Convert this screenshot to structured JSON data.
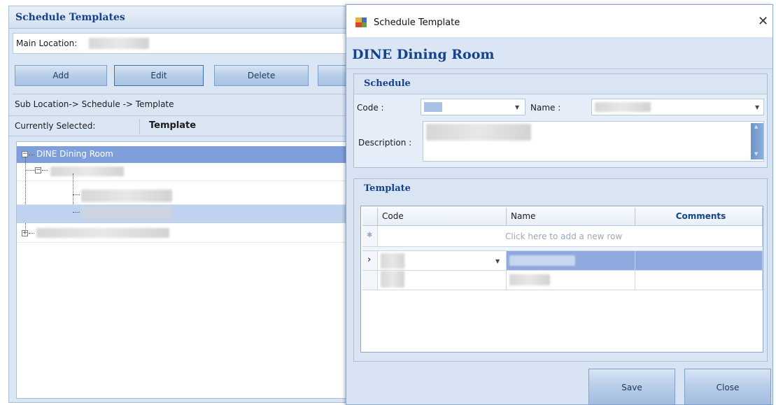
{
  "left_window": {
    "title": "Schedule Templates",
    "main_location_label": "Main Location:",
    "buttons": {
      "add": "Add",
      "edit": "Edit",
      "delete": "Delete"
    },
    "path_label": "Sub Location-> Schedule -> Template",
    "currently_selected_label": "Currently Selected:",
    "currently_selected_value": "Template",
    "tree": {
      "root_label": "DINE Dining Room"
    }
  },
  "dialog": {
    "window_title": "Schedule Template",
    "heading": "DINE Dining Room",
    "schedule_group": {
      "title": "Schedule",
      "code_label": "Code :",
      "name_label": "Name :",
      "description_label": "Description :"
    },
    "template_group": {
      "title": "Template",
      "columns": [
        "Code",
        "Name",
        "Comments"
      ],
      "new_row_hint": "Click here to add a new row"
    },
    "buttons": {
      "save": "Save",
      "close": "Close"
    },
    "close_glyph": "✕"
  },
  "colors": {
    "accent": "#15428b",
    "selection": "#8fa8de",
    "panel": "#dbe6f4"
  }
}
